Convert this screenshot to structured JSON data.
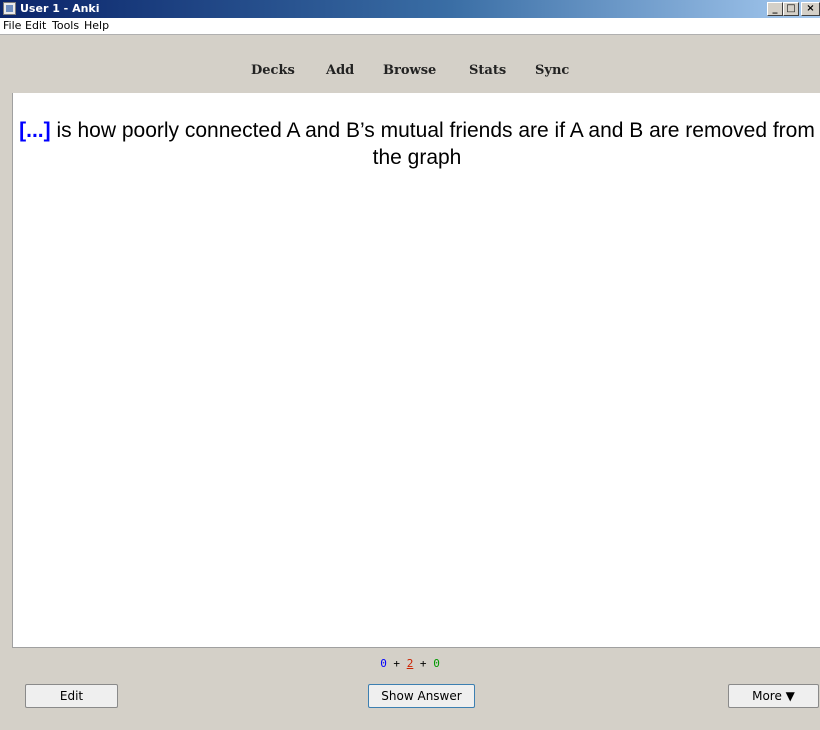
{
  "window": {
    "title": "User 1 - Anki",
    "controls": {
      "minimize": "_",
      "maximize": "□",
      "close": "×"
    }
  },
  "menu": [
    "File",
    "Edit",
    "Tools",
    "Help"
  ],
  "toolbar": [
    "Decks",
    "Add",
    "Browse",
    "Stats",
    "Sync"
  ],
  "card": {
    "cloze": "[...]",
    "question_text": " is how poorly connected A and B’s mutual friends are if A and B are removed from the graph",
    "cloze_color": "#0000ff"
  },
  "counts": {
    "new": "0",
    "sep1": " + ",
    "learning": "2",
    "sep2": " + ",
    "review": "0",
    "new_color": "#0000ff",
    "learning_color": "#cc2200",
    "review_color": "#009900"
  },
  "buttons": {
    "edit": "Edit",
    "show_answer": "Show Answer",
    "more": "More ▼"
  },
  "colors": {
    "title_bar": "#0a246a",
    "chrome": "#d4d0c8"
  }
}
